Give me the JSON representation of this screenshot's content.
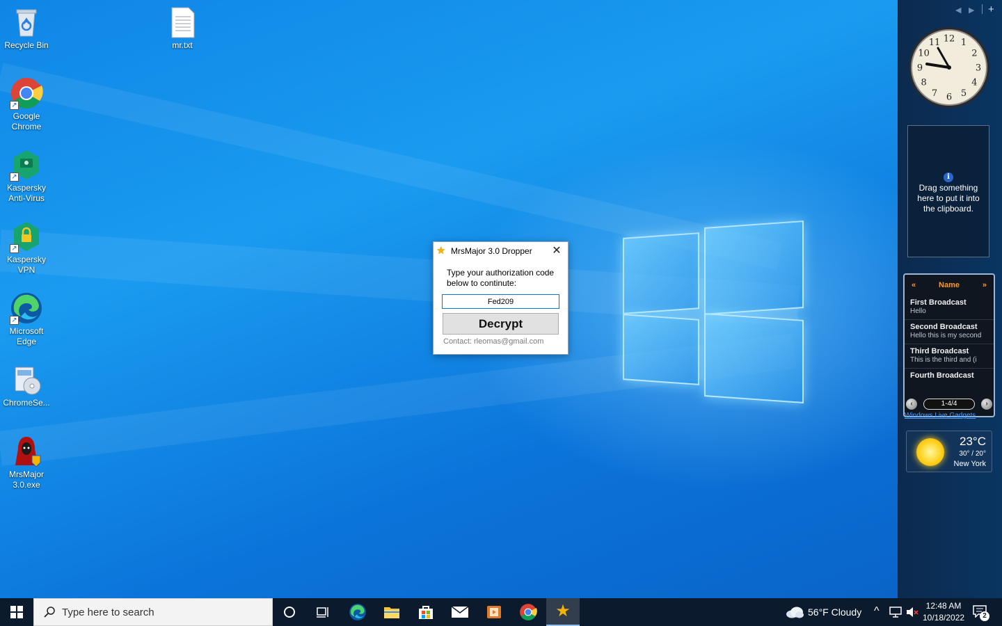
{
  "desktop": {
    "icons": [
      {
        "id": "recycle-bin",
        "label": "Recycle Bin"
      },
      {
        "id": "mr-txt",
        "label": "mr.txt"
      },
      {
        "id": "google-chrome",
        "label": "Google Chrome"
      },
      {
        "id": "kaspersky-antivirus",
        "label": "Kaspersky Anti-Virus"
      },
      {
        "id": "kaspersky-vpn",
        "label": "Kaspersky VPN"
      },
      {
        "id": "microsoft-edge",
        "label": "Microsoft Edge"
      },
      {
        "id": "chromesetup",
        "label": "ChromeSe..."
      },
      {
        "id": "mrsmajor-exe",
        "label": "MrsMajor 3.0.exe"
      }
    ]
  },
  "dialog": {
    "title": "MrsMajor 3.0 Dropper",
    "close_glyph": "✕",
    "prompt": "Type your authorization code below to continute:",
    "code_value": "Fed209",
    "decrypt_label": "Decrypt",
    "contact": "Contact: rleomas@gmail.com"
  },
  "sidebar": {
    "controls": {
      "prev": "◀",
      "next": "▶",
      "add": "+"
    },
    "clock": {
      "numerals": [
        "12",
        "1",
        "2",
        "3",
        "4",
        "5",
        "6",
        "7",
        "8",
        "9",
        "10",
        "11"
      ]
    },
    "clipboard": {
      "info_glyph": "i",
      "message": "Drag something here to put it into the clipboard."
    },
    "broadcast": {
      "header_label": "Name",
      "prev_glyph": "«",
      "next_glyph": "»",
      "items": [
        {
          "title": "First Broadcast",
          "subtitle": "Hello"
        },
        {
          "title": "Second Broadcast",
          "subtitle": "Hello this is my second"
        },
        {
          "title": "Third Broadcast",
          "subtitle": "This is the third and (i"
        },
        {
          "title": "Fourth Broadcast",
          "subtitle": ""
        }
      ],
      "page_count": "1-4/4",
      "page_prev": "‹",
      "page_next": "›",
      "footer_link": "Windows Live Gadgets"
    },
    "weather": {
      "temp": "23°C",
      "range": "30° / 20°",
      "city": "New York"
    }
  },
  "taskbar": {
    "search_placeholder": "Type here to search",
    "weather": "56°F  Cloudy",
    "time": "12:48 AM",
    "date": "10/18/2022",
    "notification_count": "2",
    "tray_chevron": "^"
  },
  "colors": {
    "wallpaper": "#0f86e6",
    "taskbar": "#0b1a2c",
    "sidebar": "#0c2a4e",
    "broadcast_header": "#ff9b1a",
    "input_focus": "#0078d7"
  }
}
